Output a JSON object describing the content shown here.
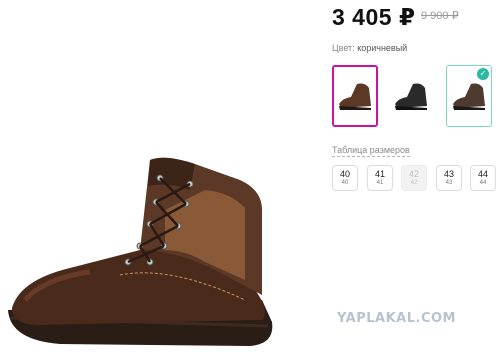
{
  "product": {
    "price": "3 405 ₽",
    "old_price": "9 900 ₽"
  },
  "color": {
    "label": "Цвет:",
    "value": "коричневый",
    "options": [
      {
        "name": "brown boot",
        "selected": true
      },
      {
        "name": "black boot",
        "selected": false
      },
      {
        "name": "brown boot alt",
        "selected": false,
        "badge": "✓"
      }
    ]
  },
  "sizes": {
    "title": "Таблица размеров",
    "items": [
      {
        "size": "40",
        "ru": "40",
        "available": true
      },
      {
        "size": "41",
        "ru": "41",
        "available": true
      },
      {
        "size": "42",
        "ru": "42",
        "available": false
      },
      {
        "size": "43",
        "ru": "43",
        "available": true
      },
      {
        "size": "44",
        "ru": "44",
        "available": true
      }
    ]
  },
  "watermark": "YAPLAKAL.COM",
  "colors": {
    "accent": "#cb11ab",
    "badge": "#2bb8a0",
    "boot_brown": "#6b3a24",
    "boot_dark": "#2a2a2a"
  }
}
